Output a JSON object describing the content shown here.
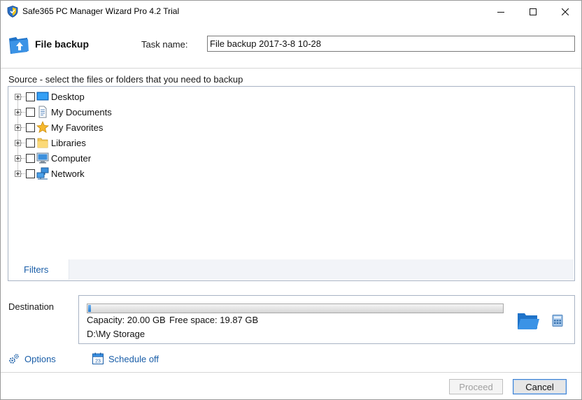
{
  "window": {
    "title": "Safe365 PC Manager Wizard Pro 4.2 Trial"
  },
  "header": {
    "title": "File backup",
    "task_label": "Task name:",
    "task_value": "File backup 2017-3-8 10-28"
  },
  "source": {
    "label": "Source - select the files or folders that you need to backup",
    "items": [
      {
        "label": "Desktop",
        "icon": "desktop-icon"
      },
      {
        "label": "My Documents",
        "icon": "documents-icon"
      },
      {
        "label": "My Favorites",
        "icon": "star-icon"
      },
      {
        "label": "Libraries",
        "icon": "folder-icon"
      },
      {
        "label": "Computer",
        "icon": "computer-icon"
      },
      {
        "label": "Network",
        "icon": "network-icon"
      }
    ],
    "filters_tab": "Filters"
  },
  "destination": {
    "label": "Destination",
    "capacity": "Capacity: 20.00 GB",
    "free_space": "Free space: 19.87 GB",
    "path": "D:\\My Storage",
    "used_fraction": 0.0065
  },
  "links": {
    "options": "Options",
    "schedule": "Schedule off"
  },
  "buttons": {
    "proceed": "Proceed",
    "cancel": "Cancel"
  },
  "colors": {
    "accent": "#1a5ea8",
    "panel_border": "#a8b3c4",
    "progress_fill": "#2a7fd0"
  }
}
